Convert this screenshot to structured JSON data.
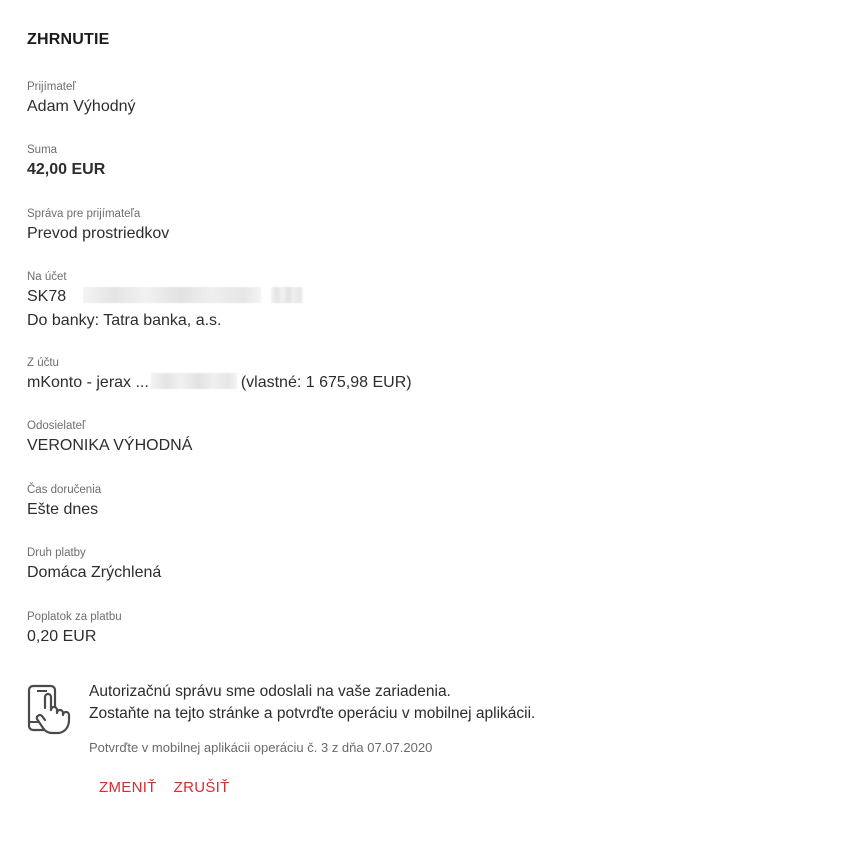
{
  "summary": {
    "title": "ZHRNUTIE",
    "recipient": {
      "label": "Prijímateľ",
      "value": "Adam Výhodný"
    },
    "amount": {
      "label": "Suma",
      "value": "42,00 EUR"
    },
    "message": {
      "label": "Správa pre prijímateľa",
      "value": "Prevod prostriedkov"
    },
    "to_account": {
      "label": "Na účet",
      "iban_prefix": "SK78",
      "bank": "Do banky: Tatra banka, a.s."
    },
    "from_account": {
      "label": "Z účtu",
      "name": "mKonto - jerax ...",
      "balance": "(vlastné: 1 675,98 EUR)"
    },
    "sender": {
      "label": "Odosielateľ",
      "value": "VERONIKA VÝHODNÁ"
    },
    "delivery": {
      "label": "Čas doručenia",
      "value": "Ešte dnes"
    },
    "payment_type": {
      "label": "Druh platby",
      "value": "Domáca Zrýchlená"
    },
    "fee": {
      "label": "Poplatok za platbu",
      "value": "0,20 EUR"
    }
  },
  "authorization": {
    "icon": "phone-tap-icon",
    "line1": "Autorizačnú správu sme odoslali na vaše zariadenia.",
    "line2": "Zostaňte na tejto stránke a potvrďte operáciu v mobilnej aplikácii.",
    "note": "Potvrďte v mobilnej aplikácii operáciu č. 3 z dňa 07.07.2020"
  },
  "actions": {
    "change_label": "ZMENIŤ",
    "cancel_label": "ZRUŠIŤ"
  },
  "colors": {
    "accent": "#e3272d",
    "label": "#6e6e6e",
    "text": "#2d2d2d"
  }
}
